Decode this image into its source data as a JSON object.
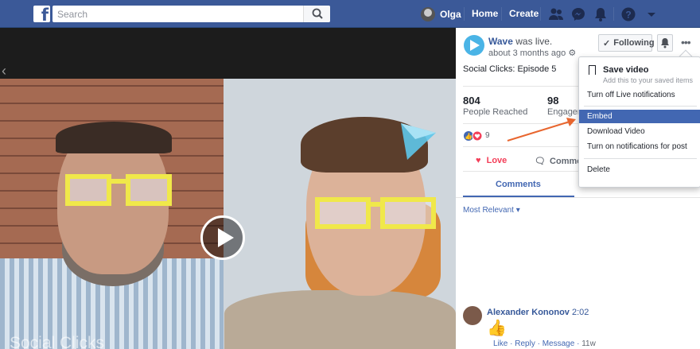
{
  "topbar": {
    "search_placeholder": "Search",
    "user_name": "Olga",
    "home": "Home",
    "create": "Create"
  },
  "video": {
    "watermark": "Social Clicks"
  },
  "post": {
    "page_name": "Wave",
    "status": "was live.",
    "time": "about 3 months ago",
    "text": "Social Clicks: Episode 5",
    "follow_label": "Following"
  },
  "stats": {
    "reached_value": "804",
    "reached_label": "People Reached",
    "engaged_value": "98",
    "engaged_label": "Engagem"
  },
  "reactions": {
    "count": "9"
  },
  "actions": {
    "love": "Love",
    "comment": "Comme"
  },
  "tabs": {
    "comments": "Comments"
  },
  "sort": {
    "label": "Most Relevant"
  },
  "comment": {
    "author": "Alexander Kononov",
    "time": "2:02",
    "emoji": "👍",
    "like": "Like",
    "reply": "Reply",
    "message": "Message",
    "age": "11w"
  },
  "menu": {
    "save_title": "Save video",
    "save_sub": "Add this to your saved items",
    "turn_off": "Turn off Live notifications",
    "embed": "Embed",
    "download": "Download Video",
    "turn_on": "Turn on notifications for post",
    "delete": "Delete"
  },
  "colors": {
    "brand": "#3b5998",
    "link": "#365899",
    "highlight": "#4267b2",
    "love": "#f33e58",
    "arrow": "#e8662f"
  }
}
